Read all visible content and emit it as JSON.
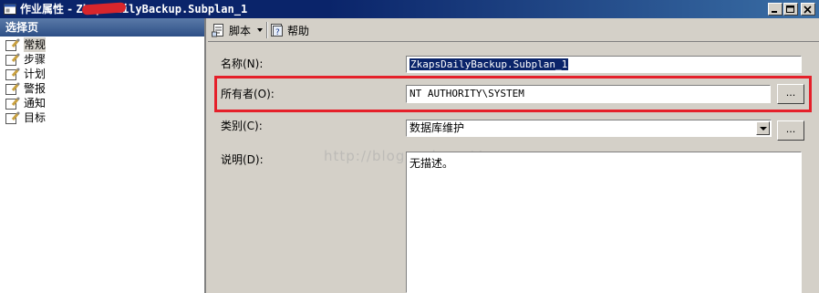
{
  "window": {
    "title_prefix": "作业属性 - ",
    "title_plan": "ZkapsDailyBackup.Subplan_1"
  },
  "left_panel": {
    "header": "选择页",
    "items": [
      {
        "label": "常规",
        "active": true
      },
      {
        "label": "步骤",
        "active": false
      },
      {
        "label": "计划",
        "active": false
      },
      {
        "label": "警报",
        "active": false
      },
      {
        "label": "通知",
        "active": false
      },
      {
        "label": "目标",
        "active": false
      }
    ]
  },
  "toolbar": {
    "script_label": "脚本",
    "help_label": "帮助"
  },
  "form": {
    "name_label": "名称(N):",
    "name_value": "ZkapsDailyBackup.Subplan_1",
    "owner_label": "所有者(O):",
    "owner_value": "NT AUTHORITY\\SYSTEM",
    "owner_button": "...",
    "category_label": "类别(C):",
    "category_value": "数据库维护",
    "category_button": "...",
    "description_label": "说明(D):",
    "description_value": "无描述。"
  },
  "watermark": "http://blog.csdn.net/",
  "colors": {
    "titlebar": "#0a246a",
    "highlight": "#e5202a",
    "face": "#d4d0c8"
  }
}
